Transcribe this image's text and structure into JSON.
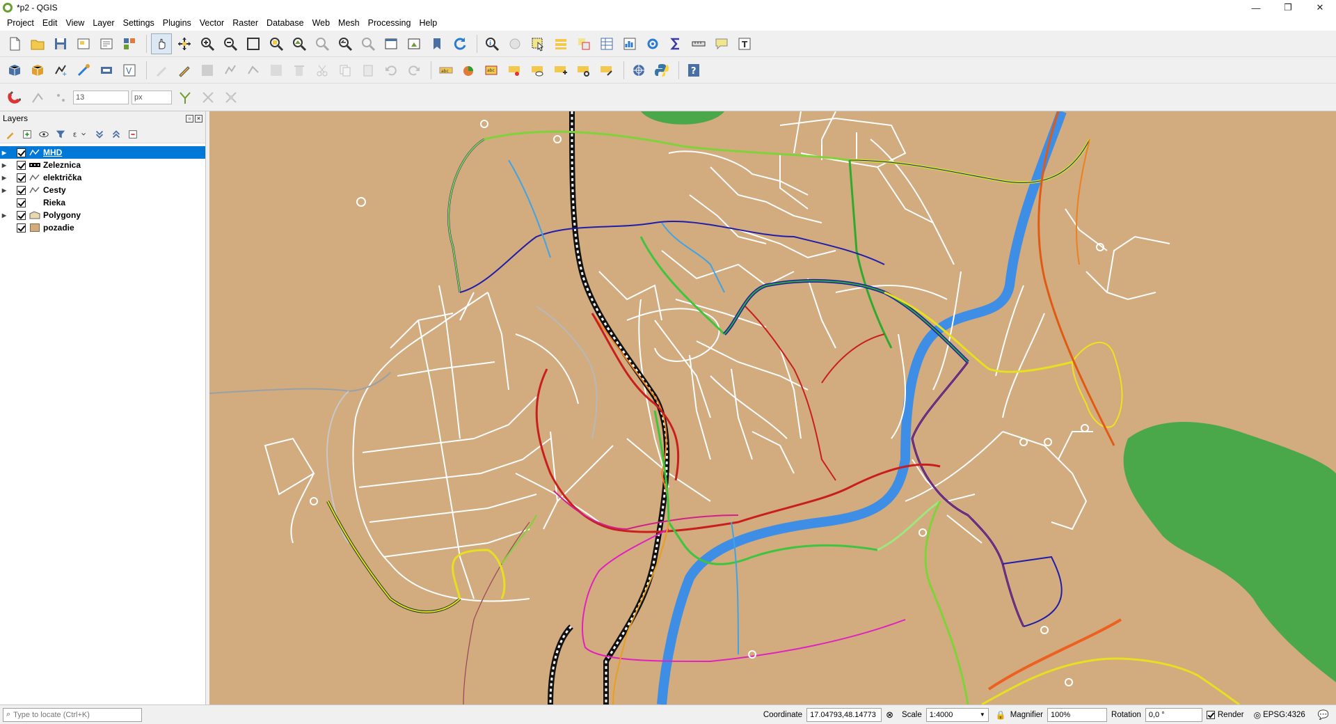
{
  "window": {
    "title": "*p2 - QGIS",
    "minimize": "—",
    "restore": "❐",
    "close": "✕"
  },
  "menu": [
    "Project",
    "Edit",
    "View",
    "Layer",
    "Settings",
    "Plugins",
    "Vector",
    "Raster",
    "Database",
    "Web",
    "Mesh",
    "Processing",
    "Help"
  ],
  "toolbar3": {
    "snap_tolerance": "13",
    "snap_units": "px"
  },
  "layers_panel": {
    "title": "Layers",
    "layers": [
      {
        "name": "MHD",
        "selected": true,
        "expandable": true,
        "symbol": "line-icon"
      },
      {
        "name": "Zeleznica",
        "selected": false,
        "expandable": true,
        "symbol": "railway-symbol"
      },
      {
        "name": "električka",
        "selected": false,
        "expandable": true,
        "symbol": "line-icon"
      },
      {
        "name": "Cesty",
        "selected": false,
        "expandable": true,
        "symbol": "line-icon"
      },
      {
        "name": "Rieka",
        "selected": false,
        "expandable": false,
        "symbol": "river-symbol"
      },
      {
        "name": "Polygony",
        "selected": false,
        "expandable": true,
        "symbol": "polygon-icon"
      },
      {
        "name": "pozadie",
        "selected": false,
        "expandable": false,
        "symbol": "fill-symbol"
      }
    ]
  },
  "map": {
    "background": "#d2ab7e",
    "colors": {
      "forest": "#4aa84a",
      "river": "#3f8ee6",
      "roads": "#ffffff",
      "railway": "#111111"
    }
  },
  "statusbar": {
    "locator_placeholder": "Type to locate (Ctrl+K)",
    "coordinate_label": "Coordinate",
    "coordinate_value": "17.04793,48.14773",
    "scale_label": "Scale",
    "scale_value": "1:4000",
    "magnifier_label": "Magnifier",
    "magnifier_value": "100%",
    "rotation_label": "Rotation",
    "rotation_value": "0,0 °",
    "render_label": "Render",
    "crs": "EPSG:4326"
  }
}
